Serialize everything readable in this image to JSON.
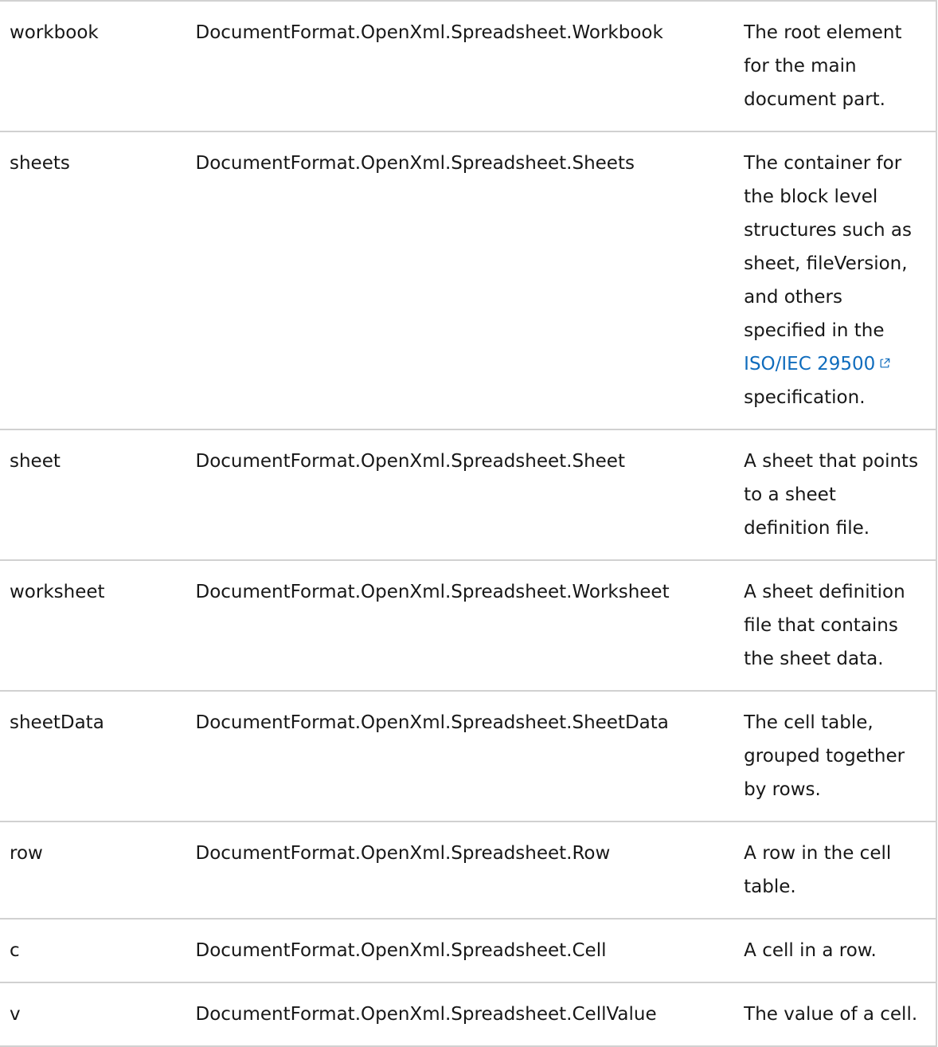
{
  "table": {
    "rows": [
      {
        "element": "workbook",
        "class": "DocumentFormat.OpenXml.Spreadsheet.Workbook",
        "description": "The root element for the main document part."
      },
      {
        "element": "sheets",
        "class": "DocumentFormat.OpenXml.Spreadsheet.Sheets",
        "description_before": "The container for the block level structures such as sheet, fileVersion, and others specified in the ",
        "link_text": "ISO/IEC 29500",
        "link_icon": "external-link-icon",
        "description_after": " specification."
      },
      {
        "element": "sheet",
        "class": "DocumentFormat.OpenXml.Spreadsheet.Sheet",
        "description": "A sheet that points to a sheet definition file."
      },
      {
        "element": "worksheet",
        "class": "DocumentFormat.OpenXml.Spreadsheet.Worksheet",
        "description": "A sheet definition file that contains the sheet data."
      },
      {
        "element": "sheetData",
        "class": "DocumentFormat.OpenXml.Spreadsheet.SheetData",
        "description": "The cell table, grouped together by rows."
      },
      {
        "element": "row",
        "class": "DocumentFormat.OpenXml.Spreadsheet.Row",
        "description": "A row in the cell table."
      },
      {
        "element": "c",
        "class": "DocumentFormat.OpenXml.Spreadsheet.Cell",
        "description": "A cell in a row."
      },
      {
        "element": "v",
        "class": "DocumentFormat.OpenXml.Spreadsheet.CellValue",
        "description": "The value of a cell."
      }
    ]
  },
  "colors": {
    "link": "#0f6cbd",
    "border": "#d1d1d1",
    "text": "#171717"
  }
}
